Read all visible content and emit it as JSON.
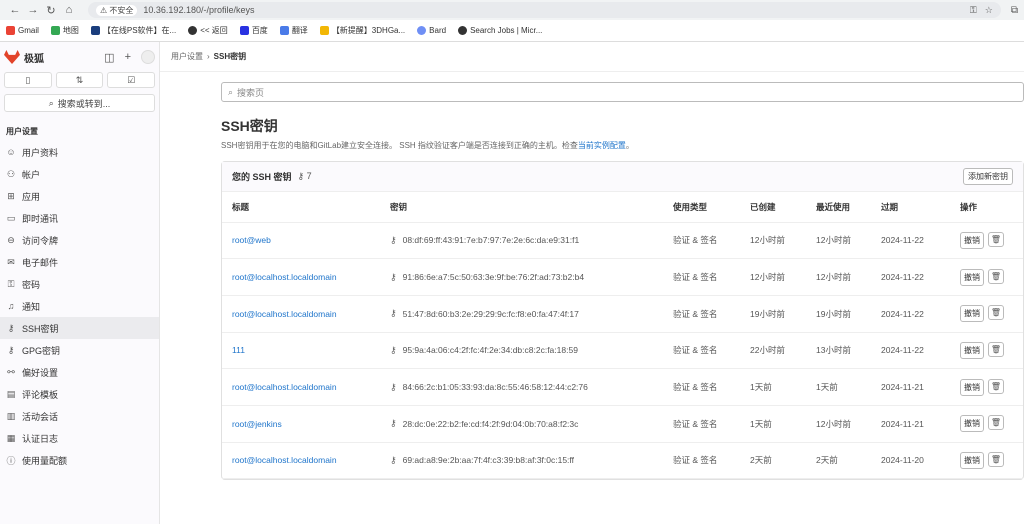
{
  "browser": {
    "insecure_label": "不安全",
    "url": "10.36.192.180/-/profile/keys",
    "bookmarks": [
      "Gmail",
      "地图",
      "【在线PS软件】在...",
      "<< 返回",
      "百度",
      "翻译",
      "【新提醒】3DHGa...",
      "Bard",
      "Search Jobs | Micr..."
    ]
  },
  "sidebar": {
    "logo_text": "极狐",
    "search_label": "搜索或转到...",
    "section_title": "用户设置",
    "items": [
      {
        "label": "用户资料",
        "icon": "person-icon"
      },
      {
        "label": "帐户",
        "icon": "account-icon"
      },
      {
        "label": "应用",
        "icon": "apps-icon"
      },
      {
        "label": "即时通讯",
        "icon": "chat-icon"
      },
      {
        "label": "访问令牌",
        "icon": "token-icon"
      },
      {
        "label": "电子邮件",
        "icon": "mail-icon"
      },
      {
        "label": "密码",
        "icon": "lock-icon"
      },
      {
        "label": "通知",
        "icon": "bell-icon"
      },
      {
        "label": "SSH密钥",
        "icon": "key-icon"
      },
      {
        "label": "GPG密钥",
        "icon": "key-icon"
      },
      {
        "label": "偏好设置",
        "icon": "preferences-icon"
      },
      {
        "label": "评论模板",
        "icon": "comment-icon"
      },
      {
        "label": "活动会话",
        "icon": "session-icon"
      },
      {
        "label": "认证日志",
        "icon": "log-icon"
      },
      {
        "label": "使用量配额",
        "icon": "info-icon"
      }
    ]
  },
  "breadcrumb": {
    "parent": "用户设置",
    "current": "SSH密钥"
  },
  "page": {
    "search_placeholder": "搜索页",
    "title": "SSH密钥",
    "desc_text": "SSH密钥用于在您的电脑和GitLab建立安全连接。 SSH 指纹验证客户端是否连接到正确的主机。检查",
    "desc_link": "当前实例配置",
    "desc_end": "。"
  },
  "card": {
    "title": "您的 SSH 密钥",
    "count": "7",
    "add_button": "添加新密钥",
    "columns": [
      "标题",
      "密钥",
      "使用类型",
      "已创建",
      "最近使用",
      "过期",
      "操作"
    ],
    "revoke_label": "撤销",
    "rows": [
      {
        "title": "root@web",
        "key": "08:df:69:ff:43:91:7e:b7:97:7e:2e:6c:da:e9:31:f1",
        "usage": "验证 & 签名",
        "created": "12小时前",
        "last_used": "12小时前",
        "expires": "2024-11-22"
      },
      {
        "title": "root@localhost.localdomain",
        "key": "91:86:6e:a7:5c:50:63:3e:9f:be:76:2f:ad:73:b2:b4",
        "usage": "验证 & 签名",
        "created": "12小时前",
        "last_used": "12小时前",
        "expires": "2024-11-22"
      },
      {
        "title": "root@localhost.localdomain",
        "key": "51:47:8d:60:b3:2e:29:29:9c:fc:f8:e0:fa:47:4f:17",
        "usage": "验证 & 签名",
        "created": "19小时前",
        "last_used": "19小时前",
        "expires": "2024-11-22"
      },
      {
        "title": "111",
        "key": "95:9a:4a:06:c4:2f:fc:4f:2e:34:db:c8:2c:fa:18:59",
        "usage": "验证 & 签名",
        "created": "22小时前",
        "last_used": "13小时前",
        "expires": "2024-11-22"
      },
      {
        "title": "root@localhost.localdomain",
        "key": "84:66:2c:b1:05:33:93:da:8c:55:46:58:12:44:c2:76",
        "usage": "验证 & 签名",
        "created": "1天前",
        "last_used": "1天前",
        "expires": "2024-11-21"
      },
      {
        "title": "root@jenkins",
        "key": "28:dc:0e:22:b2:fe:cd:f4:2f:9d:04:0b:70:a8:f2:3c",
        "usage": "验证 & 签名",
        "created": "1天前",
        "last_used": "12小时前",
        "expires": "2024-11-21"
      },
      {
        "title": "root@localhost.localdomain",
        "key": "69:ad:a8:9e:2b:aa:7f:4f:c3:39:b8:af:3f:0c:15:ff",
        "usage": "验证 & 签名",
        "created": "2天前",
        "last_used": "2天前",
        "expires": "2024-11-20"
      }
    ]
  },
  "colors": {
    "link": "#1f75cb",
    "logo": "#e2432a"
  }
}
